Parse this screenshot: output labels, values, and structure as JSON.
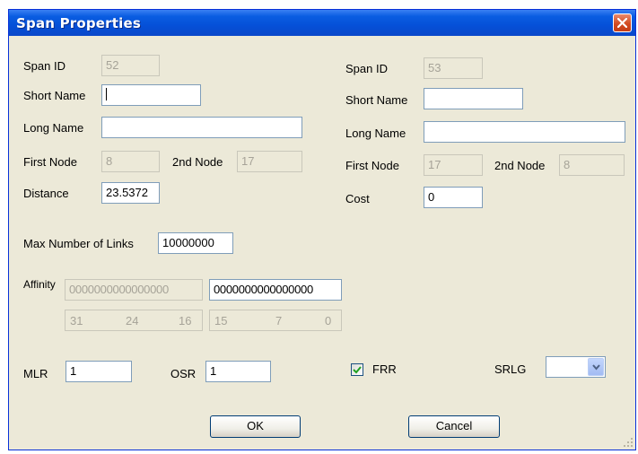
{
  "window": {
    "title": "Span Properties"
  },
  "left": {
    "span_id_label": "Span ID",
    "span_id_value": "52",
    "short_name_label": "Short Name",
    "short_name_value": "",
    "long_name_label": "Long Name",
    "long_name_value": "",
    "first_node_label": "First Node",
    "first_node_value": "8",
    "second_node_label": "2nd Node",
    "second_node_value": "17",
    "distance_label": "Distance",
    "distance_value": "23.5372"
  },
  "right": {
    "span_id_label": "Span ID",
    "span_id_value": "53",
    "short_name_label": "Short Name",
    "short_name_value": "",
    "long_name_label": "Long Name",
    "long_name_value": "",
    "first_node_label": "First Node",
    "first_node_value": "17",
    "second_node_label": "2nd Node",
    "second_node_value": "8",
    "cost_label": "Cost",
    "cost_value": "0"
  },
  "max_links": {
    "label": "Max Number of Links",
    "value": "10000000"
  },
  "affinity": {
    "label": "Affinity",
    "value_disabled": "0000000000000000",
    "value_enabled": "0000000000000000",
    "ruler_left": [
      "31",
      "24",
      "16"
    ],
    "ruler_right": [
      "15",
      "7",
      "0"
    ]
  },
  "mlr": {
    "label": "MLR",
    "value": "1"
  },
  "osr": {
    "label": "OSR",
    "value": "1"
  },
  "frr": {
    "label": "FRR",
    "checked": true
  },
  "srlg": {
    "label": "SRLG",
    "value": ""
  },
  "buttons": {
    "ok": "OK",
    "cancel": "Cancel"
  },
  "colors": {
    "titlebar": "#0a5de1",
    "dialog_bg": "#ece9d8",
    "close_button": "#d24b22",
    "field_border": "#7f9db9"
  }
}
